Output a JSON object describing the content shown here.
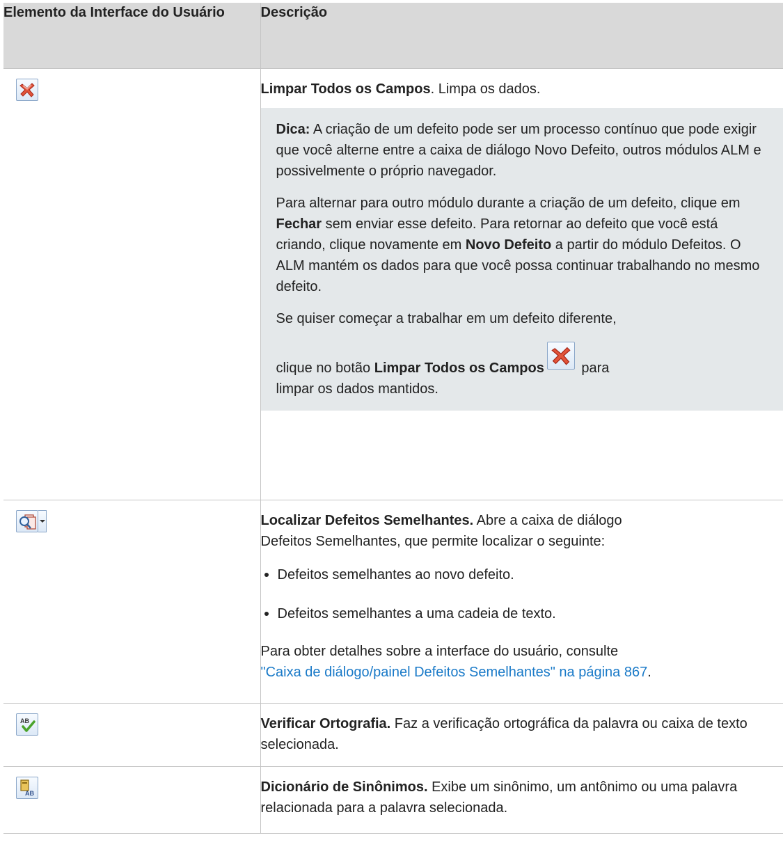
{
  "table": {
    "headers": {
      "element": "Elemento da Interface do Usuário",
      "description": "Descrição"
    },
    "rows": [
      {
        "icon": "clear-all-fields-icon",
        "title": "Limpar Todos os Campos",
        "text": ". Limpa os dados.",
        "tip": {
          "label": "Dica:",
          "p1": " A criação de um defeito pode ser um processo contínuo que pode exigir que você alterne entre a caixa de diálogo Novo Defeito, outros módulos ALM e possivelmente o próprio navegador.",
          "p2_a": "Para alternar para outro módulo durante a criação de um defeito, clique em ",
          "p2_b": "Fechar",
          "p2_c": " sem enviar esse defeito. Para retornar ao defeito que você está criando, clique novamente em ",
          "p2_d": "Novo Defeito",
          "p2_e": " a partir do módulo Defeitos. O ALM mantém os dados para que você possa continuar trabalhando no mesmo defeito.",
          "p3_a": "Se quiser começar a trabalhar em um defeito diferente,",
          "p3_b": "clique no botão ",
          "p3_c": "Limpar Todos os Campos",
          "p3_d": " para",
          "p3_e": "limpar os dados mantidos."
        }
      },
      {
        "icon": "find-similar-defects-icon",
        "title": "Localizar Defeitos Semelhantes.",
        "text_a": " Abre a caixa de diálogo",
        "text_b": "Defeitos Semelhantes, que permite localizar o seguinte:",
        "bullets": [
          "Defeitos semelhantes ao novo defeito.",
          "Defeitos semelhantes a uma cadeia de texto."
        ],
        "details": "Para obter detalhes sobre a interface do usuário, consulte",
        "link": "\"Caixa de diálogo/painel Defeitos Semelhantes\" na página 867",
        "end": "."
      },
      {
        "icon": "spell-check-icon",
        "title": "Verificar Ortografia.",
        "text": " Faz a verificação ortográfica da palavra ou caixa de texto selecionada."
      },
      {
        "icon": "thesaurus-icon",
        "title": "Dicionário de Sinônimos.",
        "text": " Exibe um sinônimo, um antônimo ou uma palavra relacionada para a palavra selecionada."
      }
    ]
  }
}
